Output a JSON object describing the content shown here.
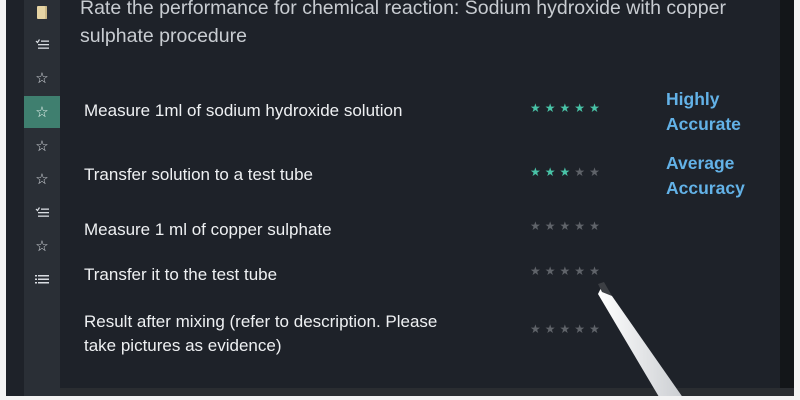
{
  "title": "Rate the performance for chemical reaction: Sodium hydroxide with copper sulphate procedure",
  "sidebar": {
    "items": [
      {
        "icon": "note-icon",
        "glyph": ""
      },
      {
        "icon": "checklist-icon",
        "glyph": ""
      },
      {
        "icon": "star-icon",
        "glyph": "☆"
      },
      {
        "icon": "star-icon",
        "glyph": "☆",
        "active": true
      },
      {
        "icon": "star-icon",
        "glyph": "☆"
      },
      {
        "icon": "star-icon",
        "glyph": "☆"
      },
      {
        "icon": "checklist-icon",
        "glyph": ""
      },
      {
        "icon": "star-icon",
        "glyph": "☆"
      },
      {
        "icon": "list-icon",
        "glyph": ""
      }
    ]
  },
  "tasks": [
    {
      "text": "Measure 1ml of sodium hydroxide solution",
      "rating": 5,
      "max": 5,
      "accuracy_line1": "Highly",
      "accuracy_line2": "Accurate"
    },
    {
      "text": "Transfer solution to a test tube",
      "rating": 3,
      "max": 5,
      "accuracy_line1": "Average",
      "accuracy_line2": "Accuracy"
    },
    {
      "text": "Measure 1 ml of copper sulphate",
      "rating": 0,
      "max": 5
    },
    {
      "text": "Transfer it to the test tube",
      "rating": 0,
      "max": 5
    },
    {
      "text_line1": "Result after mixing (refer to description. Please",
      "text_line2": "take pictures as evidence)",
      "rating": 0,
      "max": 5
    }
  ],
  "colors": {
    "accent": "#49c3a7",
    "accuracy_text": "#63b2e7",
    "active_sidebar": "#3f7f6f"
  }
}
